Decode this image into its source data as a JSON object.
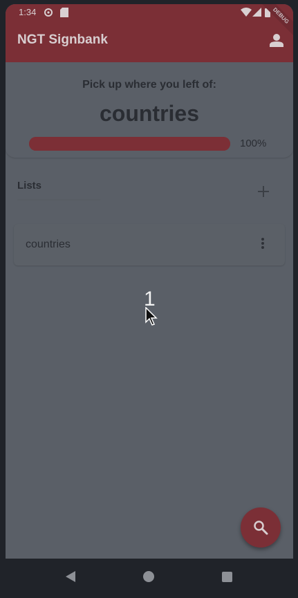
{
  "status_bar": {
    "time": "1:34",
    "icons": [
      "settings-icon",
      "sd-card-icon",
      "wifi-icon",
      "signal-icon",
      "battery-icon"
    ]
  },
  "app_bar": {
    "title": "NGT Signbank",
    "account_icon": "account-icon",
    "debug_banner": "DEBUG"
  },
  "resume": {
    "label": "Pick up where you left of:",
    "word": "countries",
    "progress_percent": 100,
    "progress_text": "100%"
  },
  "lists": {
    "title": "Lists",
    "add_icon": "plus-icon",
    "items": [
      {
        "label": "countries",
        "menu_icon": "more-vert-icon"
      }
    ]
  },
  "overlay": {
    "click_count": "1"
  },
  "fab": {
    "icon": "search-icon"
  },
  "nav": {
    "icons": [
      "back-icon",
      "home-icon",
      "recents-icon"
    ]
  },
  "colors": {
    "primary": "#7b2f36",
    "scrim_background": "#5a5f67",
    "text_dark": "#2a2d33"
  }
}
